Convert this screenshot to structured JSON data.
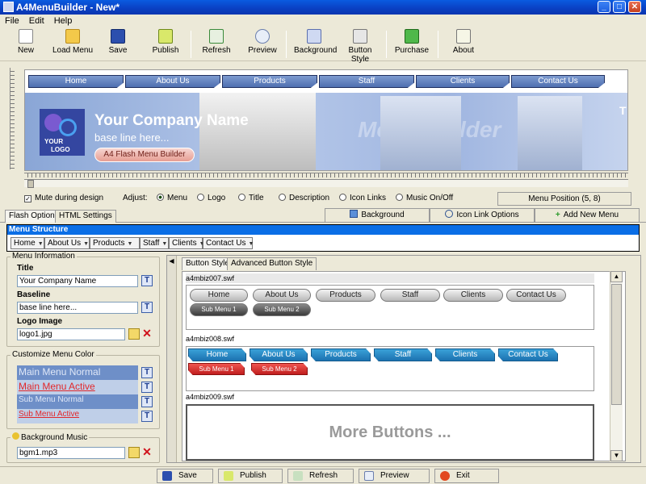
{
  "window": {
    "title": "A4MenuBuilder - New*"
  },
  "menubar": [
    "File",
    "Edit",
    "Help"
  ],
  "toolbar": {
    "new": "New",
    "load_menu": "Load Menu",
    "save": "Save",
    "publish": "Publish",
    "refresh": "Refresh",
    "preview": "Preview",
    "background": "Background",
    "button_style": "Button Style",
    "purchase": "Purchase",
    "about": "About"
  },
  "preview": {
    "nav": [
      "Home",
      "About Us",
      "Products",
      "Staff",
      "Clients",
      "Contact Us"
    ],
    "logo_line1": "YOUR",
    "logo_line2": "LOGO",
    "company": "Your Company Name",
    "baseline": "base line here...",
    "flash_button": "A4 Flash Menu Builder",
    "watermark": "Menu Builder",
    "edge_letter": "T"
  },
  "options": {
    "mute": "Mute during design",
    "adjust": "Adjust:",
    "radios": [
      "Menu",
      "Logo",
      "Title",
      "Description",
      "Icon Links",
      "Music On/Off"
    ],
    "menu_position": "Menu Position (5, 8)"
  },
  "tabs": {
    "flash_options": "Flash Options",
    "html_settings": "HTML Settings",
    "background": "Background",
    "icon_link_options": "Icon Link Options",
    "add_new_menu": "Add New Menu"
  },
  "menu_structure": {
    "title": "Menu Structure",
    "items": [
      "Home",
      "About Us",
      "Products",
      "Staff",
      "Clients",
      "Contact Us"
    ]
  },
  "menu_info": {
    "legend": "Menu Information",
    "title_label": "Title",
    "title_value": "Your Company Name",
    "baseline_label": "Baseline",
    "baseline_value": "base line here...",
    "logo_label": "Logo Image",
    "logo_value": "logo1.jpg"
  },
  "colors": {
    "legend": "Customize Menu Color",
    "main_normal": "Main Menu Normal",
    "main_active": "Main Menu Active",
    "sub_normal": "Sub Menu Normal",
    "sub_active": "Sub Menu Active",
    "accent_blue": "#0a6ee6",
    "active_red": "#e2282b"
  },
  "music": {
    "legend": "Background Music",
    "value": "bgm1.mp3"
  },
  "style_tabs": {
    "button_style": "Button Style",
    "advanced": "Advanced Button Style"
  },
  "styles": {
    "swf1": "a4mbiz007.swf",
    "swf2": "a4mbiz008.swf",
    "swf3": "a4mbiz009.swf",
    "buttons": [
      "Home",
      "About Us",
      "Products",
      "Staff",
      "Clients",
      "Contact Us"
    ],
    "sub1": "Sub Menu 1",
    "sub2": "Sub Menu 2",
    "more": "More Buttons ..."
  },
  "bottom": {
    "save": "Save",
    "publish": "Publish",
    "refresh": "Refresh",
    "preview": "Preview",
    "exit": "Exit"
  }
}
